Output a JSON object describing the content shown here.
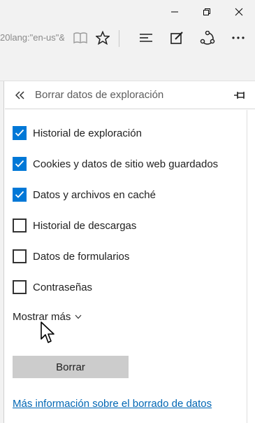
{
  "browser": {
    "address_fragment": "20lang:\"en-us\"&"
  },
  "panel": {
    "title": "Borrar datos de exploración",
    "options": [
      {
        "label": "Historial de exploración",
        "checked": true
      },
      {
        "label": "Cookies y datos de sitio web guardados",
        "checked": true
      },
      {
        "label": "Datos y archivos en caché",
        "checked": true
      },
      {
        "label": "Historial de descargas",
        "checked": false
      },
      {
        "label": "Datos de formularios",
        "checked": false
      },
      {
        "label": "Contraseñas",
        "checked": false
      }
    ],
    "show_more": "Mostrar más",
    "clear_button": "Borrar",
    "info_link": "Más información sobre el borrado de datos"
  },
  "colors": {
    "accent": "#0078d7",
    "link": "#0066b4",
    "chrome": "#f2f2f2",
    "button": "#cccccc"
  }
}
